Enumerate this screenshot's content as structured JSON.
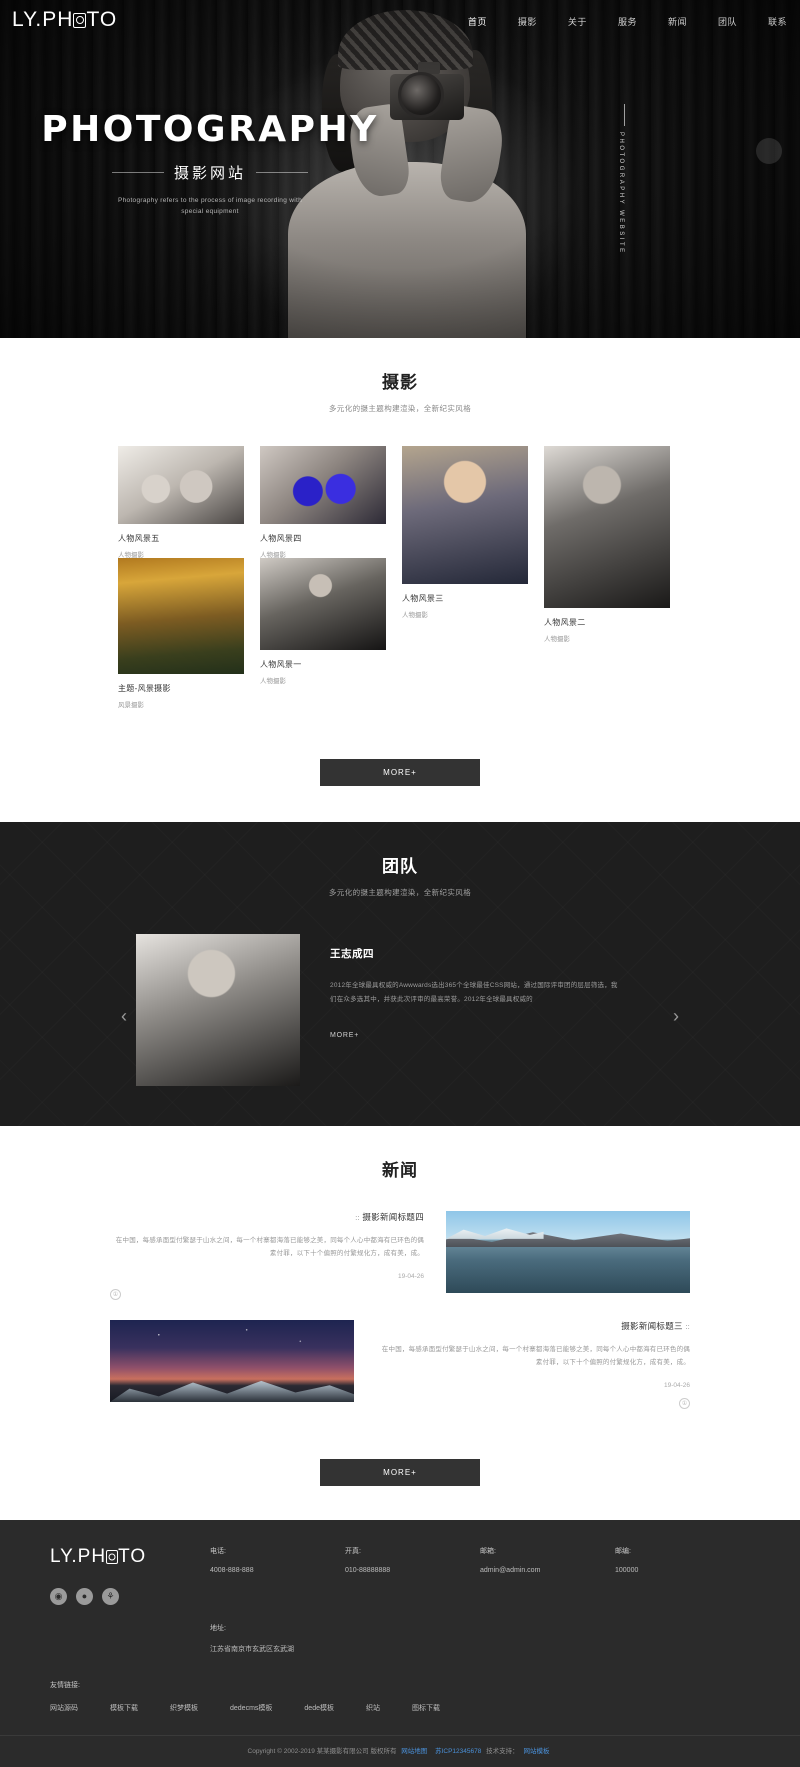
{
  "header": {
    "logo": "LY.PH",
    "logo_tail": "TO",
    "nav": [
      {
        "label": "首页",
        "active": true
      },
      {
        "label": "摄影",
        "active": false
      },
      {
        "label": "关于",
        "active": false
      },
      {
        "label": "服务",
        "active": false
      },
      {
        "label": "新闻",
        "active": false
      },
      {
        "label": "团队",
        "active": false
      },
      {
        "label": "联系",
        "active": false
      }
    ]
  },
  "hero": {
    "title": "PHOTOGRAPHY",
    "subtitle": "摄影网站",
    "description": "Photography refers to the process of image recording with special equipment",
    "vertical_text": "PHOTOGRAPHY WEBSITE"
  },
  "photography": {
    "title": "摄影",
    "subtitle": "多元化的摄主题构建渲染，全新纪实风格",
    "items": [
      {
        "caption": "人物风景五",
        "category": "人物摄影"
      },
      {
        "caption": "人物风景四",
        "category": "人物摄影"
      },
      {
        "caption": "人物风景三",
        "category": "人物摄影"
      },
      {
        "caption": "人物风景二",
        "category": "人物摄影"
      },
      {
        "caption": "主题-风景摄影",
        "category": "风景摄影"
      },
      {
        "caption": "人物风景一",
        "category": "人物摄影"
      }
    ],
    "more_label": "MORE+"
  },
  "team": {
    "title": "团队",
    "subtitle": "多元化的摄主题构建渲染，全新纪实风格",
    "member_name": "王志成四",
    "member_desc": "2012年全球最具权威的Awwwards选出365个全球最佳CSS网站，通过国际评审团的层层筛选，我们在众多选其中，并获此次评审的最高荣誉。2012年全球最具权威的",
    "more_label": "MORE+",
    "prev_icon": "‹",
    "next_icon": "›"
  },
  "news": {
    "title": "新闻",
    "items": [
      {
        "bullets": "::",
        "title": "摄影新闻标题四",
        "body": "在中国，每感承面型付繁瑟于山水之间，每一个村寨都海落已能够之美，同每个人心中都海有已环色的偶素付罪，以下十个偏照的付繁规化方，成有美，成。",
        "date": "19-04-26",
        "circle": "①"
      },
      {
        "bullets": "::",
        "title": "摄影新闻标题三",
        "body": "在中国，每感承面型付繁瑟于山水之间，每一个村寨都海落已能够之美，同每个人心中都海有已环色的偶素付罪，以下十个偏照的付繁规化方，成有美，成。",
        "date": "19-04-26",
        "circle": "①"
      }
    ],
    "more_label": "MORE+"
  },
  "footer": {
    "logo": "LY.PH",
    "logo_tail": "TO",
    "socials": [
      "qq-icon",
      "weibo-icon",
      "wechat-icon"
    ],
    "social_glyphs": [
      "◉",
      "●",
      "⚘"
    ],
    "contacts": [
      {
        "label": "电话:",
        "value": "4008-888-888"
      },
      {
        "label": "开真:",
        "value": "010-88888888"
      },
      {
        "label": "邮箱:",
        "value": "admin@admin.com"
      },
      {
        "label": "邮编:",
        "value": "100000"
      }
    ],
    "address_label": "地址:",
    "address_value": "江苏省南京市玄武区玄武湖",
    "links_title": "友情链接:",
    "links": [
      "网站源码",
      "模板下载",
      "织梦模板",
      "dedecms模板",
      "dede模板",
      "织站",
      "图标下载"
    ],
    "copyright": "Copyright © 2002-2019 某某摄影有限公司 版权所有",
    "copy_links": [
      "网站地图",
      "苏ICP12345678"
    ],
    "copy_mid": "技术支持：",
    "copy_tail": "网站模板"
  }
}
